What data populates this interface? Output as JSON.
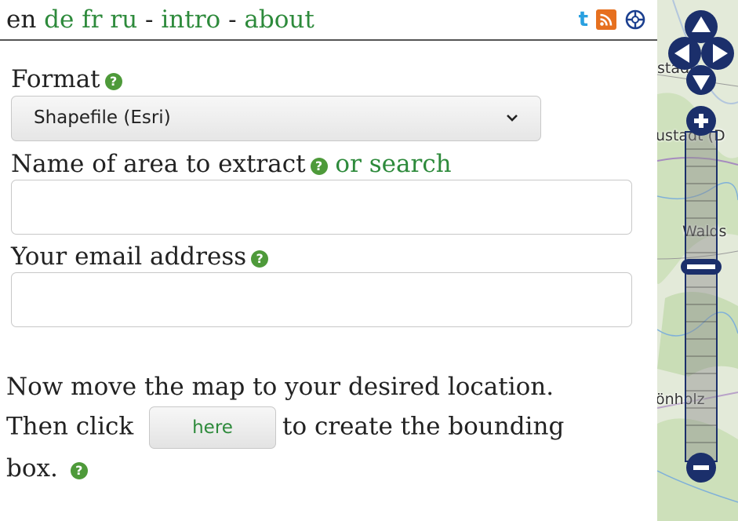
{
  "header": {
    "lang_current": "en",
    "lang_links": [
      "de",
      "fr",
      "ru"
    ],
    "sep1": "-",
    "intro_label": "intro",
    "sep2": "-",
    "about_label": "about",
    "icons": [
      "twitter-icon",
      "rss-icon",
      "crosshair-icon"
    ]
  },
  "form": {
    "format_label": "Format",
    "format_value": "Shapefile (Esri)",
    "area_label": "Name of area to extract",
    "area_search_link": "or search",
    "area_value": "",
    "email_label": "Your email address",
    "email_value": ""
  },
  "instructions": {
    "line1": "Now move the map to your desired location.",
    "then_click": "Then click",
    "here_button": "here",
    "after_button": "to create the bounding",
    "box": "box."
  },
  "map": {
    "labels": [
      "stadt",
      "ustadt (D",
      "Walds",
      "önholz"
    ]
  },
  "colors": {
    "link_green": "#2d8a3b",
    "help_green": "#4e9a3a",
    "map_control_navy": "#1b2f6b"
  }
}
